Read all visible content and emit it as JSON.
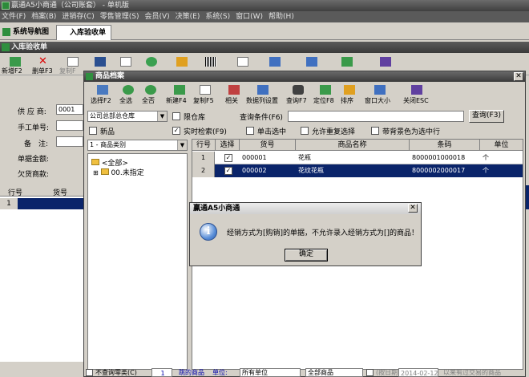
{
  "app": {
    "title": "赢通A5小商通（公司账套） - 单机版"
  },
  "menu": [
    "文件(F)",
    "档案(B)",
    "进销存(C)",
    "零售管理(S)",
    "会员(V)",
    "决策(E)",
    "系统(S)",
    "窗口(W)",
    "帮助(H)"
  ],
  "tabs": [
    {
      "label": "系统导航图"
    },
    {
      "label": "入库验收单"
    }
  ],
  "subheader": {
    "title": "入库验收单"
  },
  "main_toolbar": {
    "new_label": "新增F2",
    "delete_label": "删单F3",
    "copy_label": "复制F"
  },
  "form": {
    "supplier_label": "供 应 商:",
    "supplier_value": "0001",
    "manual_no_label": "手工单号:",
    "remark_label": "备　注:",
    "amount_label": "单据金额:",
    "owed_label": "欠货商款:"
  },
  "back_grid": {
    "col_row": "行号",
    "col_code": "货号",
    "row1": "1"
  },
  "dialog": {
    "title": "商品档案",
    "toolbar": [
      "选择F2",
      "全选",
      "全否",
      "新建F4",
      "复制F5",
      "相关",
      "数据列设置",
      "查询F7",
      "定位F8",
      "排序",
      "窗口大小",
      "关闭ESC"
    ],
    "warehouse": "公司总部总仓库",
    "limit_warehouse_label": "限仓库",
    "query_condition_label": "查询条件(F6)",
    "query_button": "查询(F3)",
    "new_product_label": "新品",
    "realtime_search_label": "实时检索(F9)",
    "single_select_label": "单击选中",
    "allow_repeat_label": "允许重复选择",
    "bg_color_label": "带背景色为选中行",
    "category_combo": "1 - 商品类别",
    "tree": {
      "root": "<全部>",
      "child": "00.未指定"
    },
    "grid": {
      "columns": [
        "行号",
        "选择",
        "货号",
        "商品名称",
        "条码",
        "单位"
      ],
      "rows": [
        {
          "no": "1",
          "checked": true,
          "code": "000001",
          "name": "花瓶",
          "barcode": "8000001000018",
          "unit": "个"
        },
        {
          "no": "2",
          "checked": true,
          "code": "000002",
          "name": "花纹花瓶",
          "barcode": "8000002000017",
          "unit": "个"
        }
      ]
    },
    "bottom": {
      "no_zero_stock": "不查询零类(C)",
      "page": "1",
      "jump_label": "跳的商品",
      "unit_label": "单位:",
      "unit_value": "所有单位",
      "all_products": "全部商品",
      "date_label": "(按日期",
      "date_value": "2014-02-12",
      "trail": "以来有过交易的商品"
    }
  },
  "message": {
    "title": "赢通A5小商通",
    "text": "经销方式为[购销]的单据，不允许录入经销方式为[]的商品！",
    "ok": "确定"
  },
  "colors": {
    "selection": "#0a246a",
    "title_dark": "#3f3f3f"
  }
}
